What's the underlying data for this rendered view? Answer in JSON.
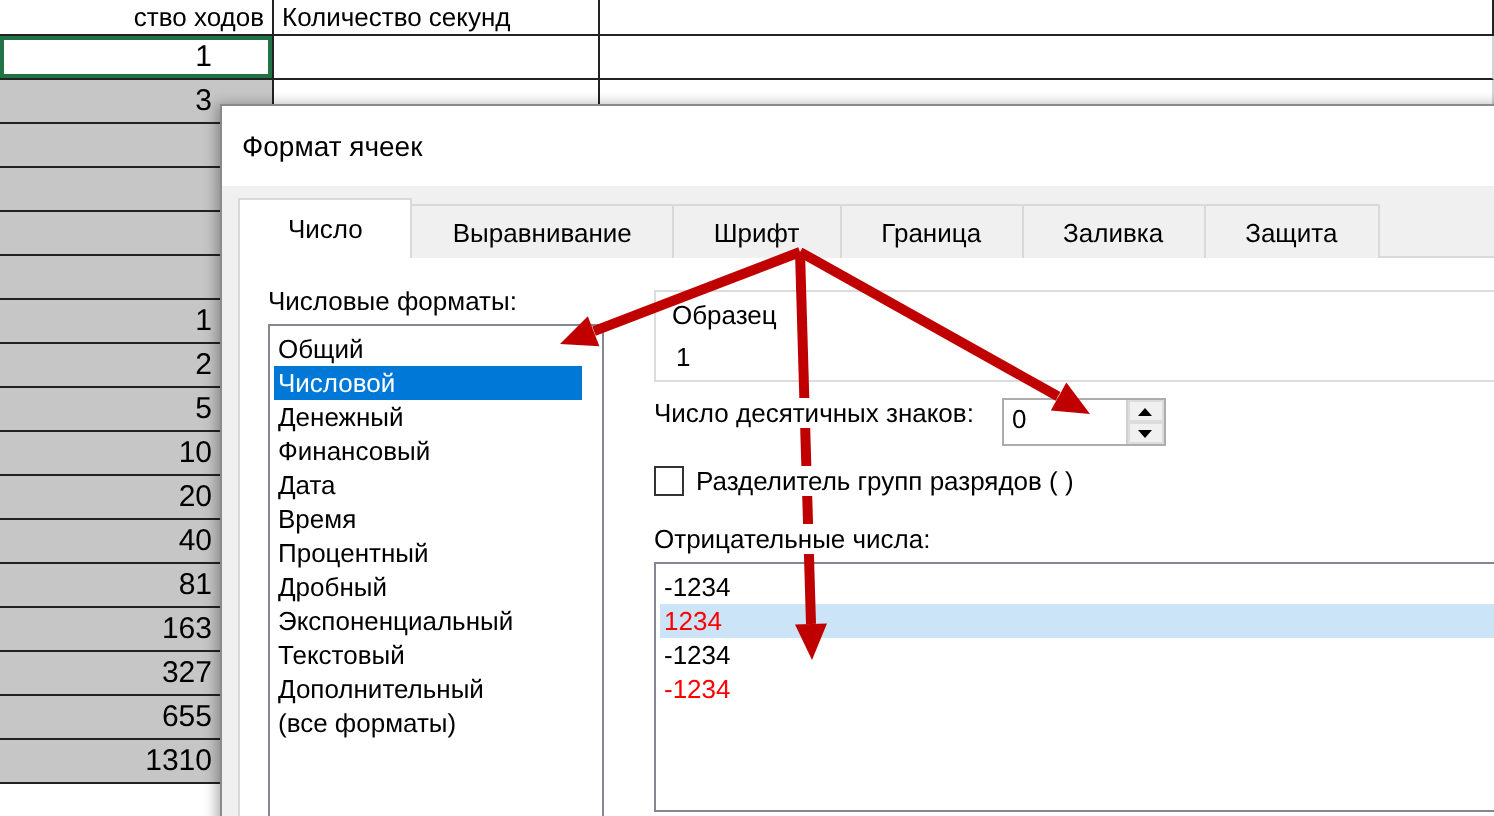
{
  "sheet": {
    "headers": [
      "ство ходов",
      "Количество секунд"
    ],
    "rows": [
      {
        "value": "1",
        "selected": false,
        "active": true
      },
      {
        "value": "3",
        "selected": true,
        "active": false
      },
      {
        "selected": true,
        "active": false
      },
      {
        "selected": true,
        "active": false
      },
      {
        "selected": true,
        "active": false
      },
      {
        "selected": true,
        "active": false
      },
      {
        "value": "1",
        "selected": true,
        "active": false
      },
      {
        "value": "2",
        "selected": true,
        "active": false
      },
      {
        "value": "5",
        "selected": true,
        "active": false
      },
      {
        "value": "10",
        "selected": true,
        "active": false
      },
      {
        "value": "20",
        "selected": true,
        "active": false
      },
      {
        "value": "40",
        "selected": true,
        "active": false
      },
      {
        "value": "81",
        "selected": true,
        "active": false
      },
      {
        "value": "163",
        "selected": true,
        "active": false
      },
      {
        "value": "327",
        "selected": true,
        "active": false
      },
      {
        "value": "655",
        "selected": true,
        "active": false
      },
      {
        "value": "1310",
        "selected": true,
        "active": false
      }
    ]
  },
  "dialog": {
    "title": "Формат ячеек",
    "tabs": [
      {
        "label": "Число",
        "selected": true
      },
      {
        "label": "Выравнивание",
        "selected": false
      },
      {
        "label": "Шрифт",
        "selected": false
      },
      {
        "label": "Граница",
        "selected": false
      },
      {
        "label": "Заливка",
        "selected": false
      },
      {
        "label": "Защита",
        "selected": false
      }
    ],
    "formats_label": "Числовые форматы:",
    "formats": [
      {
        "label": "Общий",
        "selected": false
      },
      {
        "label": "Числовой",
        "selected": true
      },
      {
        "label": "Денежный",
        "selected": false
      },
      {
        "label": "Финансовый",
        "selected": false
      },
      {
        "label": "Дата",
        "selected": false
      },
      {
        "label": "Время",
        "selected": false
      },
      {
        "label": "Процентный",
        "selected": false
      },
      {
        "label": "Дробный",
        "selected": false
      },
      {
        "label": "Экспоненциальный",
        "selected": false
      },
      {
        "label": "Текстовый",
        "selected": false
      },
      {
        "label": "Дополнительный",
        "selected": false
      },
      {
        "label": "(все форматы)",
        "selected": false
      }
    ],
    "sample": {
      "legend": "Образец",
      "value": "1"
    },
    "decimals": {
      "label": "Число десятичных знаков:",
      "value": "0"
    },
    "separator": {
      "label": "Разделитель групп разрядов ( )",
      "checked": false
    },
    "negative_label": "Отрицательные числа:",
    "negatives": [
      {
        "label": "-1234",
        "color": "#000000",
        "selected": false
      },
      {
        "label": "1234",
        "color": "#ff0000",
        "selected": true
      },
      {
        "label": "-1234",
        "color": "#000000",
        "selected": false
      },
      {
        "label": "-1234",
        "color": "#ff0000",
        "selected": false
      }
    ]
  }
}
